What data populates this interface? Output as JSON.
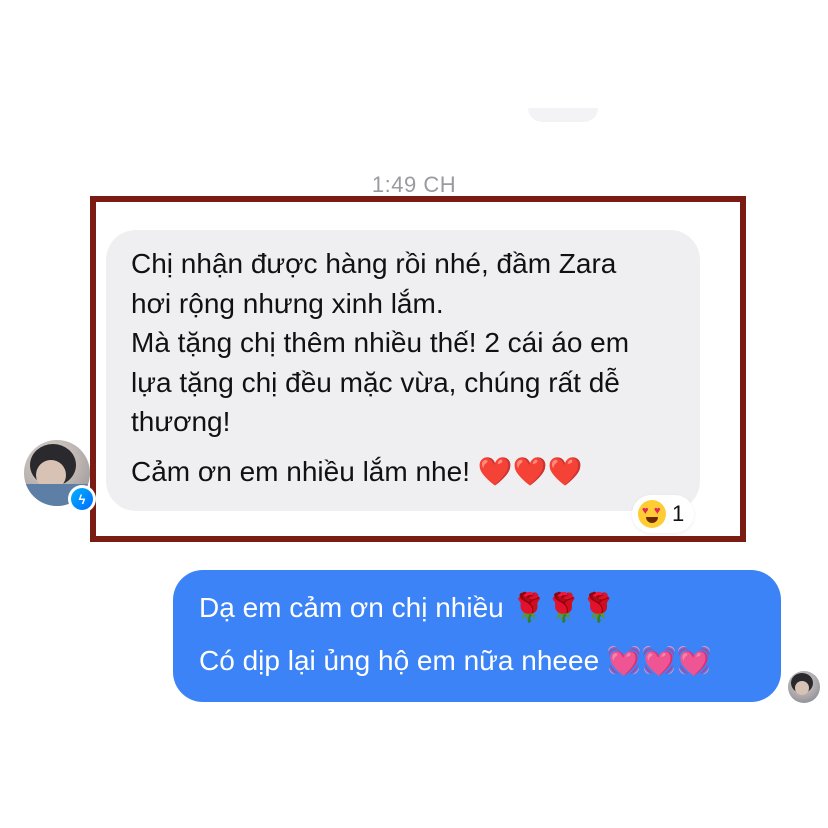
{
  "timestamp": "1:49 CH",
  "incoming_message": {
    "paragraph_1": "Chị nhận được hàng rồi nhé, đầm Zara\nhơi rộng nhưng xinh lắm.\nMà tặng chị thêm nhiều thế! 2 cái áo em\nlựa tặng chị đều mặc vừa, chúng rất dễ\nthương!",
    "paragraph_2": "Cảm ơn em nhiều lắm nhe! ❤️❤️❤️",
    "reaction_count": "1",
    "reaction_icon": "heart-eyes-emoji-icon"
  },
  "outgoing_message": {
    "line_1": "Dạ em cảm ơn chị nhiều 🌹🌹🌹",
    "line_2": "Có dịp lại ủng hộ em nữa nheee 💓💓💓"
  },
  "colors": {
    "incoming_bubble": "#efeff1",
    "outgoing_bubble": "#3b83f6",
    "highlight_border": "#7b1c14",
    "timestamp_text": "#9a9aa0"
  },
  "icons": {
    "badge": "messenger-icon",
    "sender_avatar": "avatar",
    "read_receipt": "avatar"
  }
}
